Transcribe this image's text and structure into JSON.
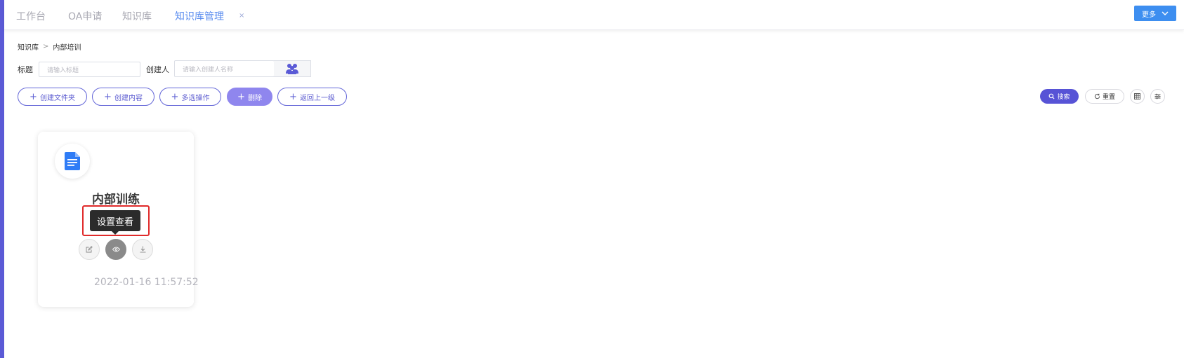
{
  "tabs": [
    {
      "label": "工作台"
    },
    {
      "label": "OA申请"
    },
    {
      "label": "知识库"
    },
    {
      "label": "知识库管理",
      "close": "×"
    }
  ],
  "more_button": {
    "label": "更多"
  },
  "breadcrumb": {
    "root": "知识库",
    "separator": ">",
    "current": "内部培训"
  },
  "filters": {
    "title_label": "标题",
    "title_placeholder": "请输入标题",
    "creator_label": "创建人",
    "creator_placeholder": "请输入创建人名称"
  },
  "actions": {
    "create_folder": "创建文件夹",
    "create_content": "创建内容",
    "multi_select": "多选操作",
    "delete": "删除",
    "go_up": "返回上一级",
    "plus": "+"
  },
  "toolbar": {
    "search": "搜索",
    "reset": "重置"
  },
  "card": {
    "title": "内部训练",
    "tooltip": "设置查看",
    "date": "2022-01-16 11:57:52"
  },
  "colors": {
    "accent": "#5753d6",
    "active_tab": "#5b8def",
    "more_button": "#3d8ef0",
    "highlight": "#e02a2a",
    "doc_icon": "#2f7cf6"
  },
  "icons": [
    "chevron-down-icon",
    "people-icon",
    "search-icon",
    "refresh-icon",
    "grid-icon",
    "filter-icon",
    "document-icon",
    "edit-icon",
    "eye-icon",
    "download-icon"
  ]
}
